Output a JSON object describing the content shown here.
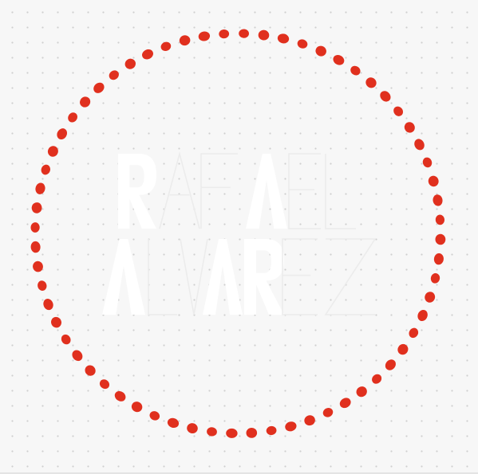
{
  "logo": {
    "name_line_1": "RAFAEL",
    "name_line_2": "ALVAREZ",
    "text_color": "#ffffff",
    "thin_stroke_color": "#ececec"
  },
  "ring": {
    "dot_color": "#e0301e",
    "dot_count": 64
  },
  "background": {
    "color": "#f7f7f7",
    "dot_grid_color": "#cfcfcf"
  }
}
